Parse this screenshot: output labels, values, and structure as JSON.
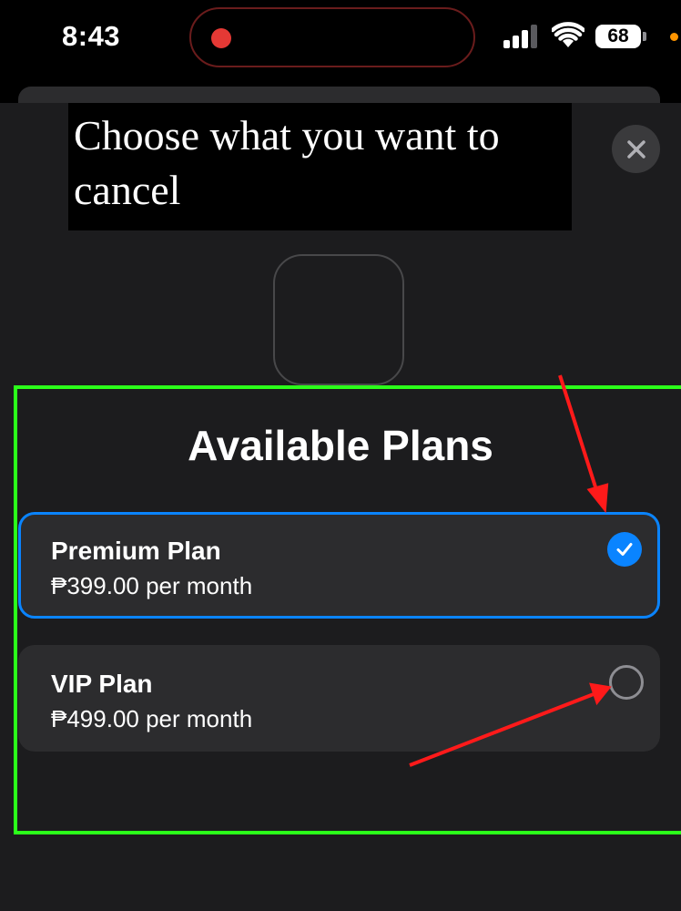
{
  "status_bar": {
    "time": "8:43",
    "battery": "68",
    "icons": [
      "record-icon",
      "signal-icon",
      "wifi-icon",
      "battery-icon"
    ]
  },
  "dialog": {
    "title": "Choose what you want to cancel",
    "close_icon": "close-icon",
    "section_title": "Available Plans"
  },
  "plans": [
    {
      "name": "Premium Plan",
      "price": "₱399.00 per month",
      "selected": true
    },
    {
      "name": "VIP Plan",
      "price": "₱499.00 per month",
      "selected": false
    }
  ],
  "colors": {
    "accent": "#0a84ff",
    "annotation_highlight": "#2bff1a",
    "annotation_arrow": "#ff1a1a",
    "record_dot": "#e53935"
  }
}
